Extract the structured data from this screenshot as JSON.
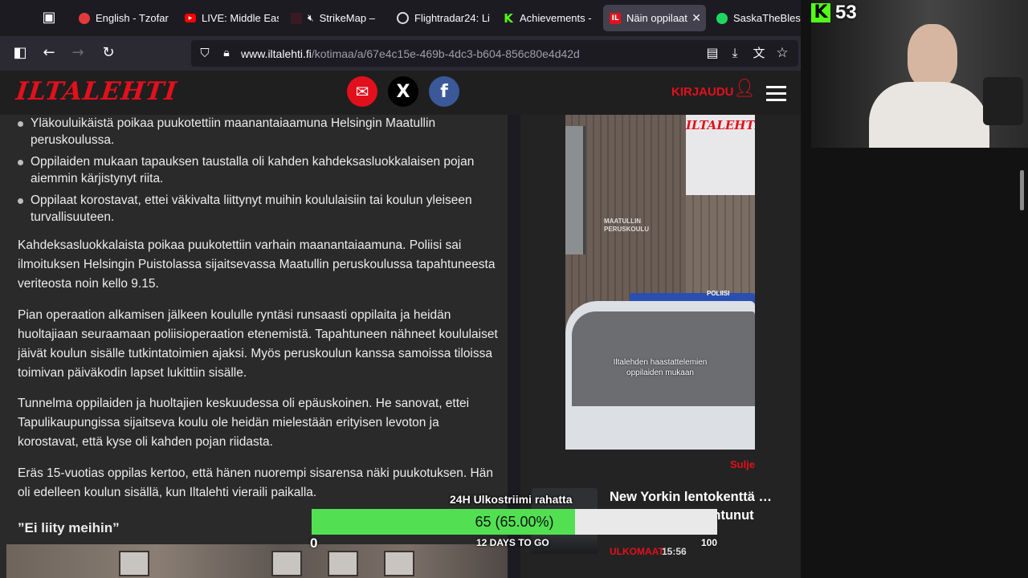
{
  "browser": {
    "tabs": [
      {
        "label": "English - Tzofar",
        "icon": "tzofar-icon",
        "color": "#e23a3a"
      },
      {
        "label": "LIVE: Middle Eas",
        "icon": "youtube-icon",
        "color": "#ff0000"
      },
      {
        "label": "StrikeMap –",
        "icon": "strikemap-icon",
        "color": "#8a1a2a"
      },
      {
        "label": "Flightradar24: Li",
        "icon": "flightradar-icon",
        "color": "#dddddd"
      },
      {
        "label": "Achievements -",
        "icon": "kick-icon",
        "color": "#53fc18"
      },
      {
        "label": "Näin oppilaat",
        "icon": "iltalehti-icon",
        "color": "#e2101c"
      },
      {
        "label": "SaskaTheBlesse",
        "icon": "spotify-icon",
        "color": "#1ed760"
      }
    ],
    "url_host": "www.iltalehti.fi",
    "url_path": "/kotimaa/a/67e4c15e-469b-4dc3-b604-856c80e4d42d"
  },
  "site": {
    "logo": "ILTALEHTI",
    "login_label": "KIRJAUDU",
    "social": [
      {
        "name": "email",
        "glyph": "✉",
        "color": "#e2101c"
      },
      {
        "name": "x",
        "glyph": "𝕏",
        "color": "#000000"
      },
      {
        "name": "facebook",
        "glyph": "f",
        "color": "#3b5998"
      }
    ]
  },
  "article": {
    "bullets": [
      "Yläkouluikäistä poikaa puukotettiin maanantaiaamuna Helsingin Maatullin peruskoulussa.",
      "Oppilaiden mukaan tapauksen taustalla oli kahden kahdeksasluokkalaisen pojan aiemmin kärjistynyt riita.",
      "Oppilaat korostavat, ettei väkivalta liittynyt muihin koululaisiin tai koulun yleiseen turvallisuuteen."
    ],
    "paragraphs": [
      "Kahdeksasluokkalaista poikaa puukotettiin varhain maanantaiaamuna. Poliisi sai ilmoituksen Helsingin Puistolassa sijaitsevassa Maatullin peruskoulussa tapahtuneesta veriteosta noin kello 9.15.",
      "Pian operaation alkamisen jälkeen koululle ryntäsi runsaasti oppilaita ja heidän huoltajiaan seuraamaan poliisioperaation etenemistä. Tapahtuneen nähneet koululaiset jäivät koulun sisälle tutkintatoimien ajaksi. Myös peruskoulun kanssa samoissa tiloissa toimivan päiväkodin lapset lukittiin sisälle.",
      "Tunnelma oppilaiden ja huoltajien keskuudessa oli epäuskoinen. He sanovat, ettei Tapulikaupungissa sijaitseva koulu ole heidän mielestään erityisen levoton ja korostavat, että kyse oli kahden pojan riidasta.",
      "Eräs 15-vuotias oppilas kertoo, että hänen nuorempi sisarensa näki puukotuksen. Hän oli edelleen koulun sisällä, kun Iltalehti vieraili paikalla."
    ],
    "subheading": "”Ei liity meihin”"
  },
  "sidebar": {
    "video": {
      "watermark": "ILTALEHTI",
      "sign": "MAATULLIN PERUSKOULU",
      "caption_line1": "Iltalehden haastattelemien",
      "caption_line2": "oppilaiden mukaan",
      "police_text": "POLIISI"
    },
    "close_label": "Sulje",
    "news": {
      "title": "New Yorkin lentokenttä … ollut, 41 loukkaantunut",
      "category": "ULKOMAAT",
      "time": "15:56"
    }
  },
  "overlay": {
    "kick_count": "53",
    "kick_color": "#53fc18",
    "subathon_label": "24H Ulkostriimi rahatta",
    "progress_text": "65 (65.00%)",
    "progress_fraction": 0.65,
    "progress_color": "#52e052",
    "min_label": "0",
    "days_label": "12 DAYS TO GO",
    "max_label": "100"
  }
}
